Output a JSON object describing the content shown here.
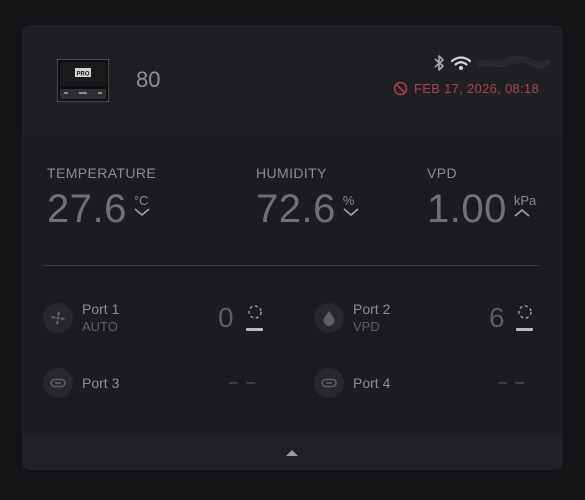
{
  "header": {
    "device_id": "80",
    "device_thumbnail_text": "PRO",
    "status_icons": [
      "bluetooth-icon",
      "wifi-icon"
    ],
    "offline_icon": "no-connection-icon",
    "datetime": "FEB 17, 2026, 08:18"
  },
  "metrics": [
    {
      "label": "TEMPERATURE",
      "value": "27.6",
      "unit": "°C",
      "trend": "down"
    },
    {
      "label": "HUMIDITY",
      "value": "72.6",
      "unit": "%",
      "trend": "down"
    },
    {
      "label": "VPD",
      "value": "1.00",
      "unit": "kPa",
      "trend": "up"
    }
  ],
  "ports": [
    {
      "name": "Port 1",
      "mode": "AUTO",
      "level": "0",
      "icon": "fan-icon"
    },
    {
      "name": "Port 2",
      "mode": "VPD",
      "level": "6",
      "icon": "droplet-icon"
    },
    {
      "name": "Port 3",
      "mode": "",
      "level": "– –",
      "icon": "plug-icon"
    },
    {
      "name": "Port 4",
      "mode": "",
      "level": "– –",
      "icon": "plug-icon"
    }
  ],
  "colors": {
    "background": "#141416",
    "card": "#1b1c1f",
    "alert": "#a8454a"
  }
}
